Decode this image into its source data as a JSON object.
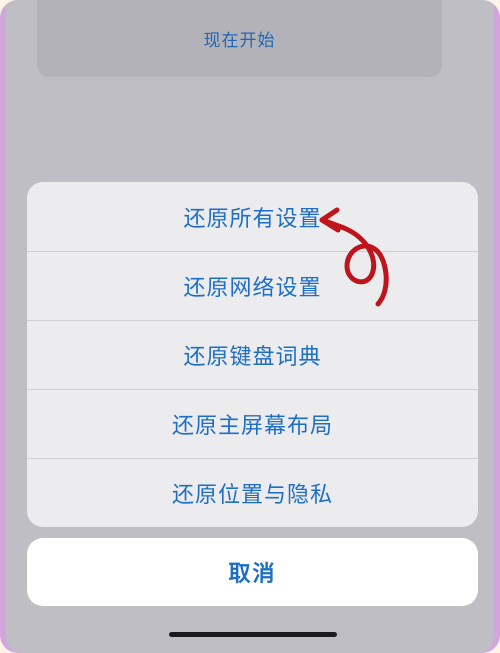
{
  "top_card": {
    "label": "现在开始"
  },
  "action_sheet": {
    "items": [
      {
        "label": "还原所有设置"
      },
      {
        "label": "还原网络设置"
      },
      {
        "label": "还原键盘词典"
      },
      {
        "label": "还原主屏幕布局"
      },
      {
        "label": "还原位置与隐私"
      }
    ],
    "cancel_label": "取消"
  },
  "colors": {
    "frame": "#d2a6dd",
    "dimmed_background": "#bebec4",
    "sheet_background": "#ececee",
    "action_text": "#1d6ec4",
    "annotation_arrow": "#c0141c"
  }
}
